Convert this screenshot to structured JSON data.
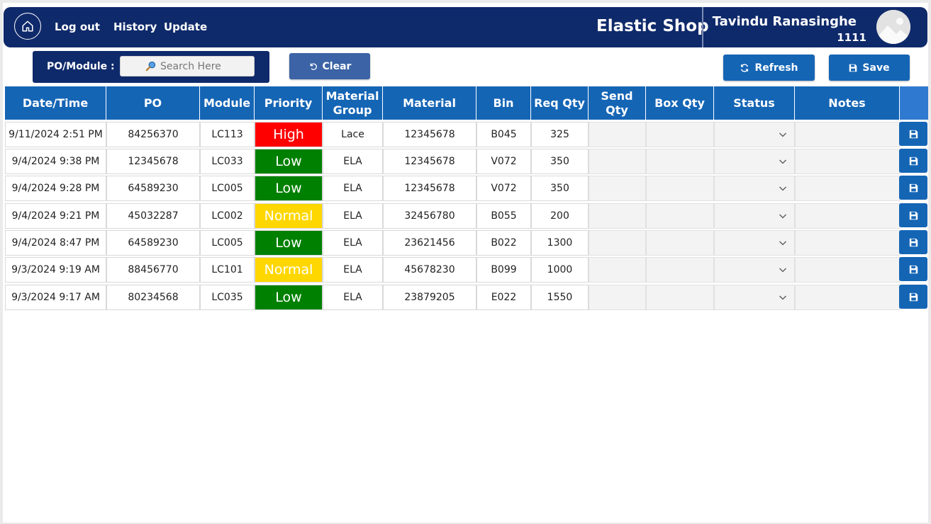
{
  "header": {
    "nav": {
      "logout": "Log out",
      "history": "History",
      "update": "Update"
    },
    "title": "Elastic Shop",
    "user": {
      "name": "Tavindu Ranasinghe",
      "id": "1111"
    },
    "icons": {
      "home": "home-icon",
      "avatar": "image-placeholder-icon"
    }
  },
  "toolbar": {
    "search_label": "PO/Module :",
    "search_placeholder": "Search Here",
    "search_value": "",
    "clear_label": "Clear",
    "refresh_label": "Refresh",
    "save_label": "Save"
  },
  "colors": {
    "header_bg": "#0f2a6b",
    "accent": "#1565b5",
    "priority_high": "#ff0000",
    "priority_low": "#008000",
    "priority_normal": "#ffd700"
  },
  "table": {
    "columns": [
      "Date/Time",
      "PO",
      "Module",
      "Priority",
      "Material Group",
      "Material",
      "Bin",
      "Req Qty",
      "Send Qty",
      "Box Qty",
      "Status",
      "Notes"
    ],
    "rows": [
      {
        "datetime": "9/11/2024 2:51 PM",
        "po": "84256370",
        "module": "LC113",
        "priority": "High",
        "material_group": "Lace",
        "material": "12345678",
        "bin": "B045",
        "req_qty": "325",
        "send_qty": "",
        "box_qty": "",
        "status": "",
        "notes": ""
      },
      {
        "datetime": "9/4/2024 9:38 PM",
        "po": "12345678",
        "module": "LC033",
        "priority": "Low",
        "material_group": "ELA",
        "material": "12345678",
        "bin": "V072",
        "req_qty": "350",
        "send_qty": "",
        "box_qty": "",
        "status": "",
        "notes": ""
      },
      {
        "datetime": "9/4/2024 9:28 PM",
        "po": "64589230",
        "module": "LC005",
        "priority": "Low",
        "material_group": "ELA",
        "material": "12345678",
        "bin": "V072",
        "req_qty": "350",
        "send_qty": "",
        "box_qty": "",
        "status": "",
        "notes": ""
      },
      {
        "datetime": "9/4/2024 9:21 PM",
        "po": "45032287",
        "module": "LC002",
        "priority": "Normal",
        "material_group": "ELA",
        "material": "32456780",
        "bin": "B055",
        "req_qty": "200",
        "send_qty": "",
        "box_qty": "",
        "status": "",
        "notes": ""
      },
      {
        "datetime": "9/4/2024 8:47 PM",
        "po": "64589230",
        "module": "LC005",
        "priority": "Low",
        "material_group": "ELA",
        "material": "23621456",
        "bin": "B022",
        "req_qty": "1300",
        "send_qty": "",
        "box_qty": "",
        "status": "",
        "notes": ""
      },
      {
        "datetime": "9/3/2024 9:19 AM",
        "po": "88456770",
        "module": "LC101",
        "priority": "Normal",
        "material_group": "ELA",
        "material": "45678230",
        "bin": "B099",
        "req_qty": "1000",
        "send_qty": "",
        "box_qty": "",
        "status": "",
        "notes": ""
      },
      {
        "datetime": "9/3/2024 9:17 AM",
        "po": "80234568",
        "module": "LC035",
        "priority": "Low",
        "material_group": "ELA",
        "material": "23879205",
        "bin": "E022",
        "req_qty": "1550",
        "send_qty": "",
        "box_qty": "",
        "status": "",
        "notes": ""
      }
    ]
  }
}
